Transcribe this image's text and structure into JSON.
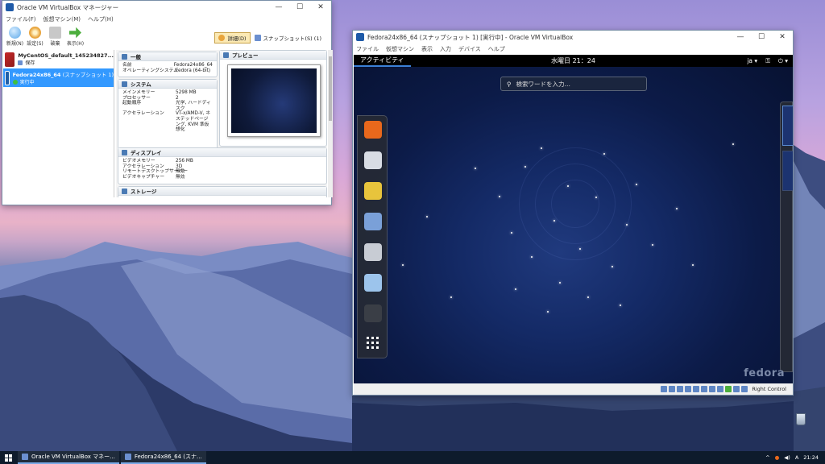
{
  "manager": {
    "title": "Oracle VM VirtualBox マネージャー",
    "menu": [
      "ファイル(F)",
      "仮想マシン(M)",
      "ヘルプ(H)"
    ],
    "toolbar": [
      {
        "label": "新規(N)",
        "icon": "new-vm-icon",
        "color": "#5aa7e8"
      },
      {
        "label": "設定(S)",
        "icon": "settings-gear-icon",
        "color": "#e8a43c"
      },
      {
        "label": "破棄",
        "icon": "discard-icon",
        "color": "#b8b8b8"
      },
      {
        "label": "表示(H)",
        "icon": "show-arrow-icon",
        "color": "#4cae3c"
      }
    ],
    "details_button": "詳細(D)",
    "snapshot_button": "スナップショット(S) (1)",
    "vms": [
      {
        "name": "MyCentOS_default_145234827...",
        "state": "保存"
      },
      {
        "name": "Fedora24x86_64",
        "snapshot": "(スナップショット 1)",
        "state": "実行中"
      }
    ],
    "general": {
      "header": "一般",
      "rows": [
        {
          "k": "名前",
          "v": "Fedora24x86_64"
        },
        {
          "k": "オペレーティングシステム",
          "v": "Fedora (64-bit)"
        }
      ]
    },
    "preview_header": "プレビュー",
    "system": {
      "header": "システム",
      "rows": [
        {
          "k": "メインメモリー",
          "v": "5298 MB"
        },
        {
          "k": "プロセッサー",
          "v": "2"
        },
        {
          "k": "起動順序",
          "v": "光学, ハードディスク"
        },
        {
          "k": "アクセラレーション",
          "v": "VT-x/AMD-V, ネステッドページング, KVM 準仮想化"
        }
      ]
    },
    "display": {
      "header": "ディスプレイ",
      "rows": [
        {
          "k": "ビデオメモリー",
          "v": "256 MB"
        },
        {
          "k": "アクセラレーション",
          "v": "3D"
        },
        {
          "k": "リモートデスクトップサーバー",
          "v": "無効"
        },
        {
          "k": "ビデオキャプチャー",
          "v": "無効"
        }
      ]
    },
    "storage_header": "ストレージ"
  },
  "vmwindow": {
    "title": "Fedora24x86_64 (スナップショット 1) [実行中] - Oracle VM VirtualBox",
    "menu": [
      "ファイル",
      "仮想マシン",
      "表示",
      "入力",
      "デバイス",
      "ヘルプ"
    ],
    "guest": {
      "activities": "アクティビティ",
      "clock": "水曜日 21：24",
      "lang": "ja ▾",
      "network_icon": "network-icon",
      "power": "⏻ ▾",
      "search_placeholder": "検索ワードを入力…",
      "brand": "fedora",
      "dash_apps": [
        {
          "name": "firefox-icon",
          "color": "#e8681c"
        },
        {
          "name": "clock-icon",
          "color": "#d8dce4"
        },
        {
          "name": "rhythmbox-icon",
          "color": "#e8c43c"
        },
        {
          "name": "photos-icon",
          "color": "#7aa0d8"
        },
        {
          "name": "files-icon",
          "color": "#c8ccd4"
        },
        {
          "name": "software-icon",
          "color": "#9cc4ec"
        },
        {
          "name": "terminal-icon",
          "color": "#3a3e46"
        }
      ],
      "apps_grid_icon": "show-apps-icon"
    },
    "status_right_control": "Right Control"
  },
  "taskbar": {
    "tasks": [
      {
        "label": "Oracle VM VirtualBox マネー..."
      },
      {
        "label": "Fedora24x86_64 (スナ..."
      }
    ],
    "tray": [
      "^",
      "A"
    ],
    "time": "21:24"
  }
}
